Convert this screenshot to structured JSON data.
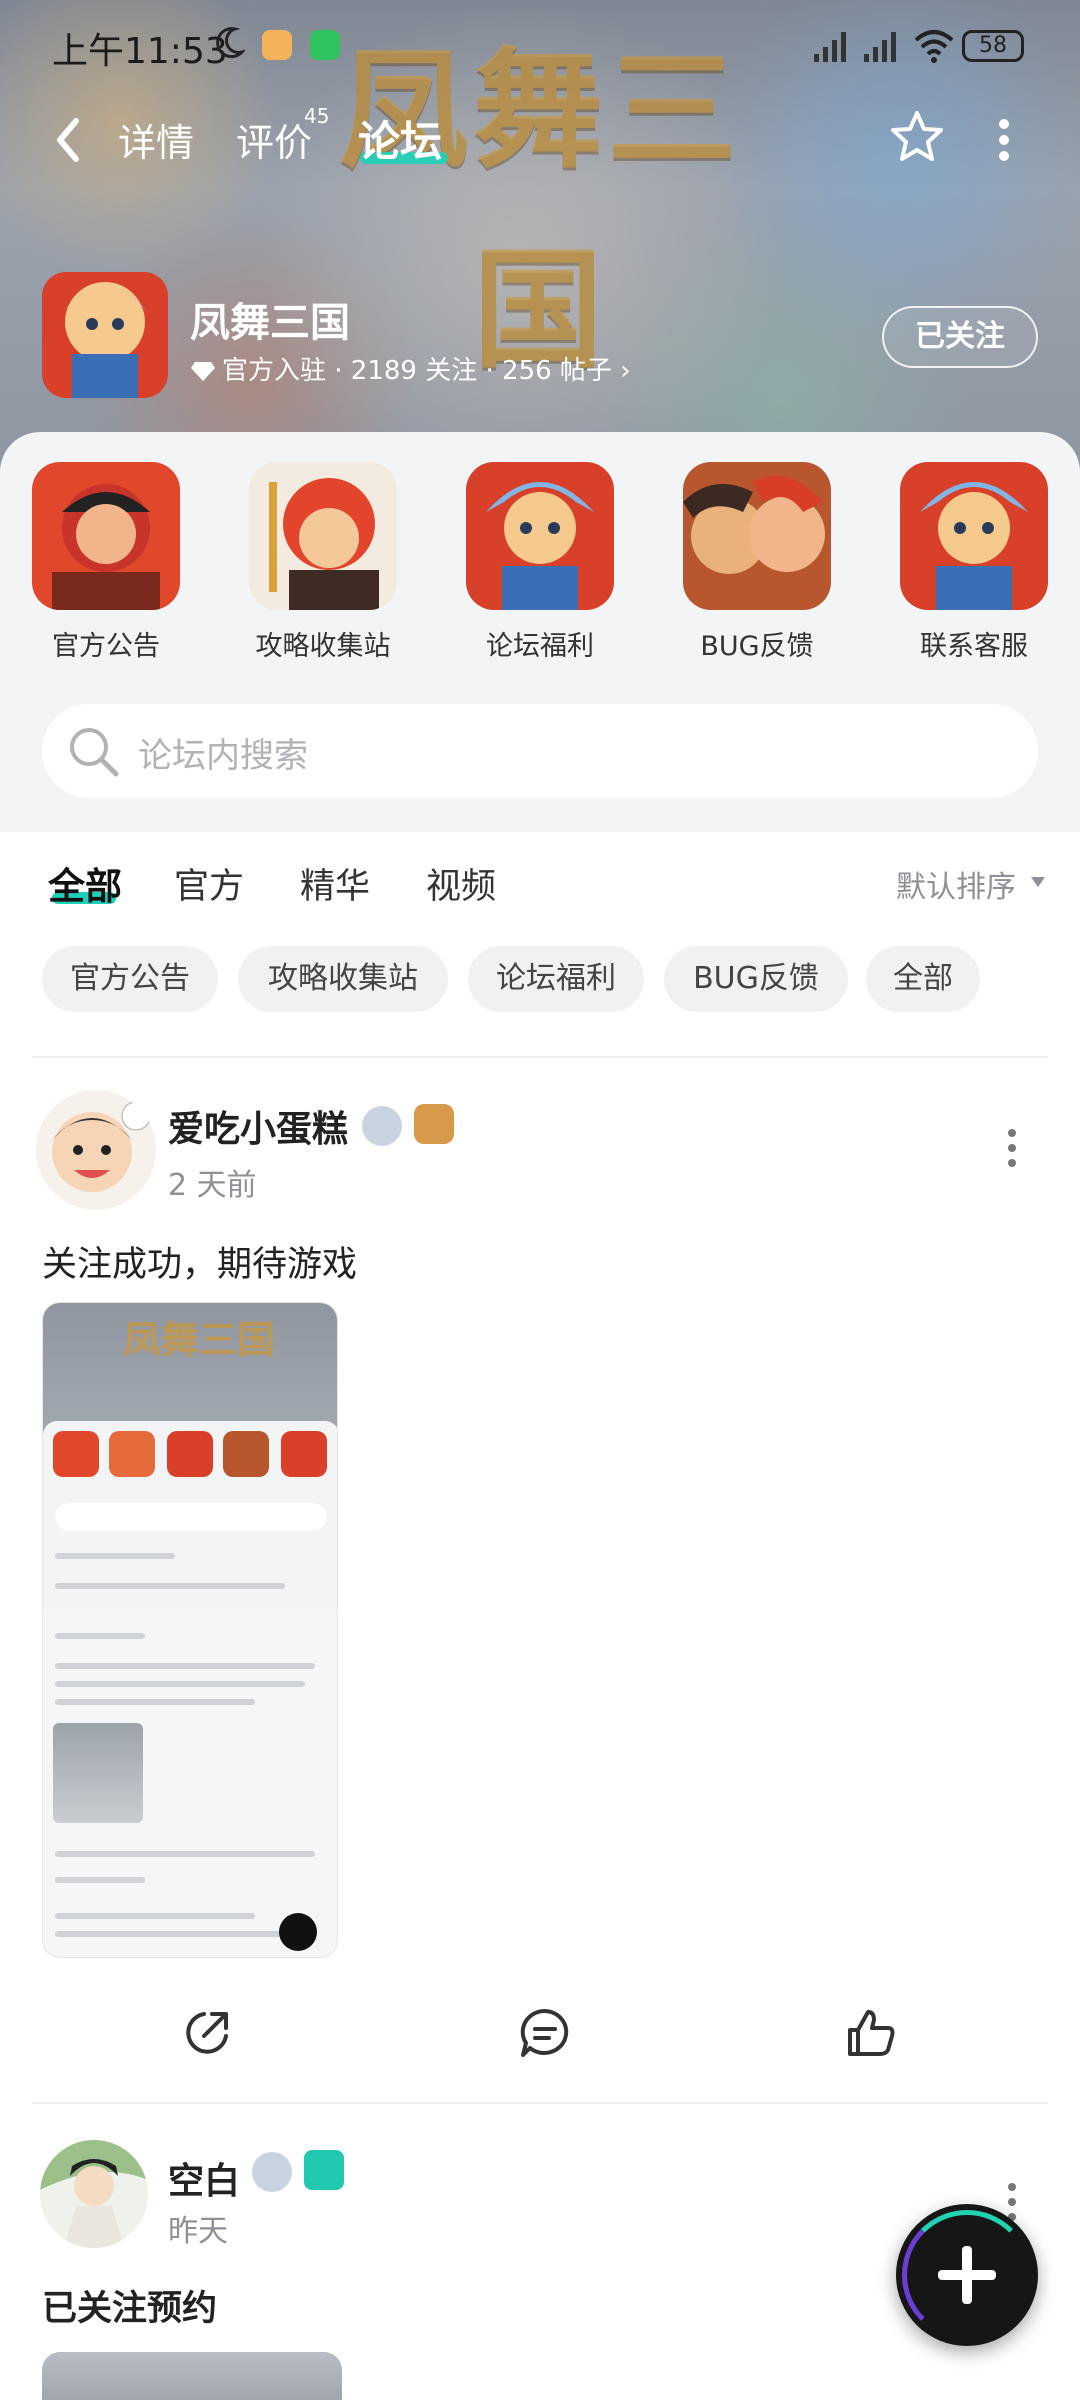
{
  "status": {
    "time": "上午11:53",
    "battery": "58"
  },
  "nav": {
    "tabs": [
      "详情",
      "评价",
      "论坛"
    ],
    "review_count": "45",
    "active_tab": "论坛"
  },
  "game": {
    "name": "凤舞三国",
    "banner_title": "凤舞三国",
    "meta": "官方入驻 · 2189 关注 · 256 帖子",
    "follow_label": "已关注"
  },
  "categories": [
    {
      "label": "官方公告"
    },
    {
      "label": "攻略收集站"
    },
    {
      "label": "论坛福利"
    },
    {
      "label": "BUG反馈"
    },
    {
      "label": "联系客服"
    }
  ],
  "search": {
    "placeholder": "论坛内搜索"
  },
  "filter_tabs": [
    "全部",
    "官方",
    "精华",
    "视频"
  ],
  "sort_label": "默认排序",
  "chips": [
    "官方公告",
    "攻略收集站",
    "论坛福利",
    "BUG反馈",
    "全部"
  ],
  "posts": [
    {
      "username": "爱吃小蛋糕",
      "time": "2 天前",
      "text": "关注成功，期待游戏"
    },
    {
      "username": "空白",
      "time": "昨天",
      "text": "已关注预约"
    }
  ],
  "colors": {
    "accent": "#1fd1b8",
    "fab": "#161616"
  },
  "icons": [
    "back-icon",
    "star-icon",
    "more-icon",
    "search-icon",
    "share-icon",
    "comment-icon",
    "like-icon",
    "plus-icon"
  ]
}
